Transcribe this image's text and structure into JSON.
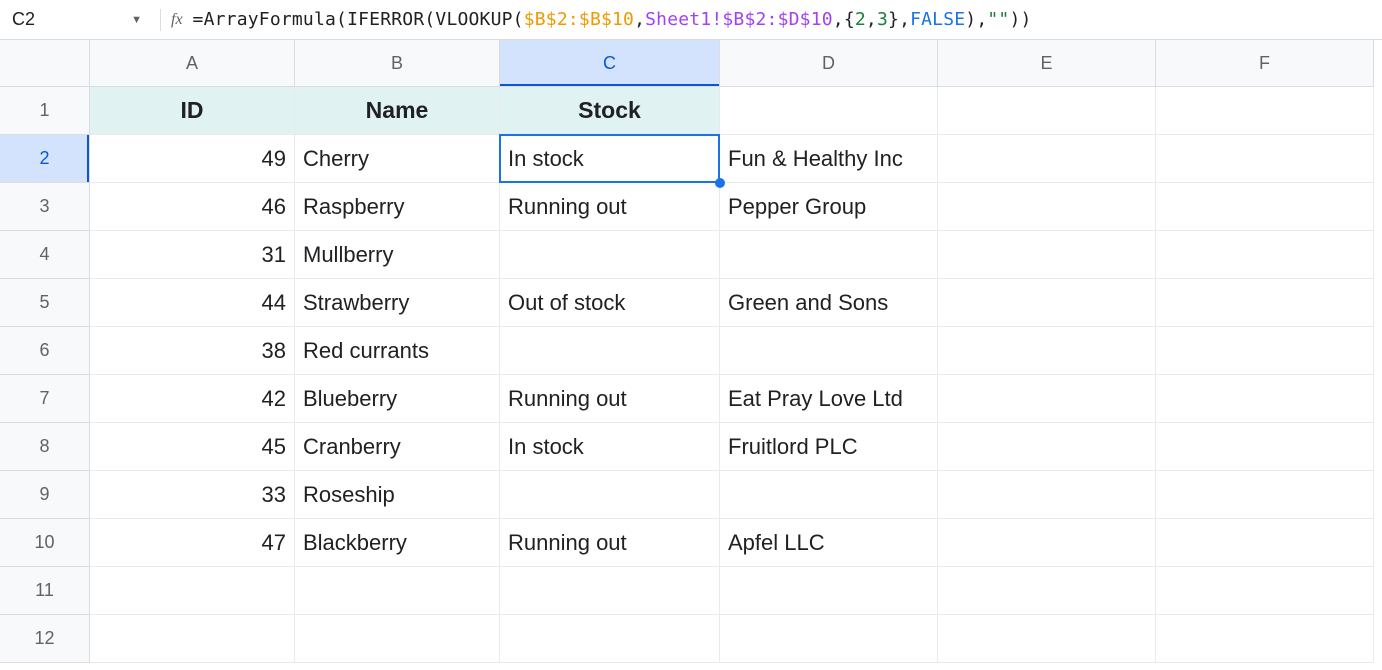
{
  "name_box": "C2",
  "formula": {
    "parts": [
      {
        "t": "=",
        "c": "fn"
      },
      {
        "t": "ArrayFormula",
        "c": "fn"
      },
      {
        "t": "(",
        "c": "fn"
      },
      {
        "t": "IFERROR",
        "c": "fn"
      },
      {
        "t": "(",
        "c": "fn"
      },
      {
        "t": "VLOOKUP",
        "c": "fn"
      },
      {
        "t": "(",
        "c": "fn"
      },
      {
        "t": "$B$2:$B$10",
        "c": "ref1"
      },
      {
        "t": ",",
        "c": "fn"
      },
      {
        "t": "Sheet1!$B$2:$D$10",
        "c": "ref2"
      },
      {
        "t": ",",
        "c": "fn"
      },
      {
        "t": "{",
        "c": "fn"
      },
      {
        "t": "2",
        "c": "arr"
      },
      {
        "t": ",",
        "c": "fn"
      },
      {
        "t": "3",
        "c": "arr"
      },
      {
        "t": "}",
        "c": "fn"
      },
      {
        "t": ",",
        "c": "fn"
      },
      {
        "t": "FALSE",
        "c": "fls"
      },
      {
        "t": ")",
        "c": "fn"
      },
      {
        "t": ",",
        "c": "fn"
      },
      {
        "t": "\"\"",
        "c": "str"
      },
      {
        "t": ")",
        "c": "fn"
      },
      {
        "t": ")",
        "c": "fn"
      }
    ]
  },
  "columns": [
    "A",
    "B",
    "C",
    "D",
    "E",
    "F"
  ],
  "selected_col_index": 2,
  "row_labels": [
    "1",
    "2",
    "3",
    "4",
    "5",
    "6",
    "7",
    "8",
    "9",
    "10",
    "11",
    "12"
  ],
  "selected_row_index": 1,
  "headers": {
    "A": "ID",
    "B": "Name",
    "C": "Stock"
  },
  "data": [
    {
      "A": "49",
      "B": "Cherry",
      "C": "In stock",
      "D": "Fun & Healthy Inc"
    },
    {
      "A": "46",
      "B": "Raspberry",
      "C": "Running out",
      "D": "Pepper Group"
    },
    {
      "A": "31",
      "B": "Mullberry",
      "C": "",
      "D": ""
    },
    {
      "A": "44",
      "B": "Strawberry",
      "C": "Out of stock",
      "D": "Green and Sons"
    },
    {
      "A": "38",
      "B": "Red currants",
      "C": "",
      "D": ""
    },
    {
      "A": "42",
      "B": "Blueberry",
      "C": "Running out",
      "D": "Eat Pray Love Ltd"
    },
    {
      "A": "45",
      "B": "Cranberry",
      "C": "In stock",
      "D": "Fruitlord PLC"
    },
    {
      "A": "33",
      "B": "Roseship",
      "C": "",
      "D": ""
    },
    {
      "A": "47",
      "B": "Blackberry",
      "C": "Running out",
      "D": "Apfel LLC"
    },
    {
      "A": "",
      "B": "",
      "C": "",
      "D": ""
    },
    {
      "A": "",
      "B": "",
      "C": "",
      "D": ""
    }
  ],
  "active_cell": "C2"
}
